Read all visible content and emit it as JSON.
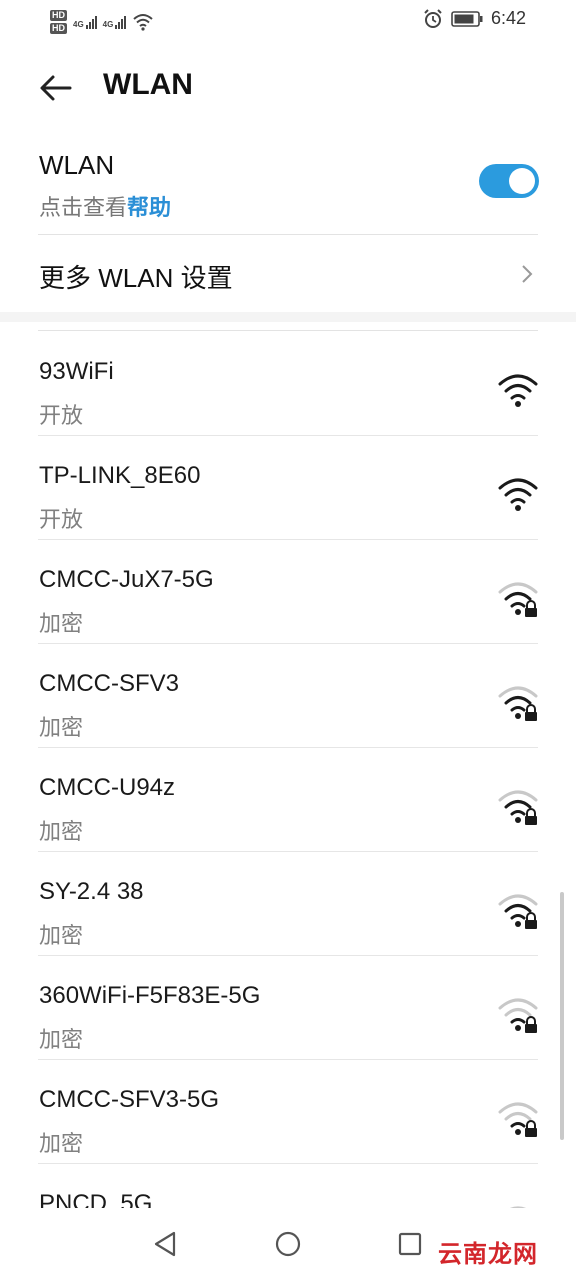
{
  "status_bar": {
    "hd1": "HD",
    "hd2": "HD",
    "net1": "4G",
    "net2": "4G",
    "time": "6:42",
    "icons": [
      "signal-icon",
      "wifi-status-icon",
      "alarm-icon",
      "battery-icon"
    ]
  },
  "header": {
    "title": "WLAN",
    "back_icon": "back-arrow-icon"
  },
  "wlan_toggle": {
    "label": "WLAN",
    "sub_text": "点击查看",
    "help_link": "帮助",
    "enabled": true,
    "accent": "#2b9bde"
  },
  "more_settings": {
    "label": "更多 WLAN 设置",
    "icon": "chevron-right-icon"
  },
  "networks": [
    {
      "name": "93WiFi",
      "security": "开放",
      "locked": false,
      "strength": 4
    },
    {
      "name": "TP-LINK_8E60",
      "security": "开放",
      "locked": false,
      "strength": 4
    },
    {
      "name": "CMCC-JuX7-5G",
      "security": "加密",
      "locked": true,
      "strength": 3
    },
    {
      "name": "CMCC-SFV3",
      "security": "加密",
      "locked": true,
      "strength": 3
    },
    {
      "name": "CMCC-U94z",
      "security": "加密",
      "locked": true,
      "strength": 3
    },
    {
      "name": "SY-2.4 38",
      "security": "加密",
      "locked": true,
      "strength": 3
    },
    {
      "name": "360WiFi-F5F83E-5G",
      "security": "加密",
      "locked": true,
      "strength": 2
    },
    {
      "name": "CMCC-SFV3-5G",
      "security": "加密",
      "locked": true,
      "strength": 2
    },
    {
      "name": "PNCD_5G",
      "security": "",
      "locked": false,
      "strength": 1
    }
  ],
  "nav_bar": {
    "back": "nav-back-icon",
    "home": "nav-home-icon",
    "recents": "nav-recents-icon"
  },
  "watermark": "云南龙网"
}
